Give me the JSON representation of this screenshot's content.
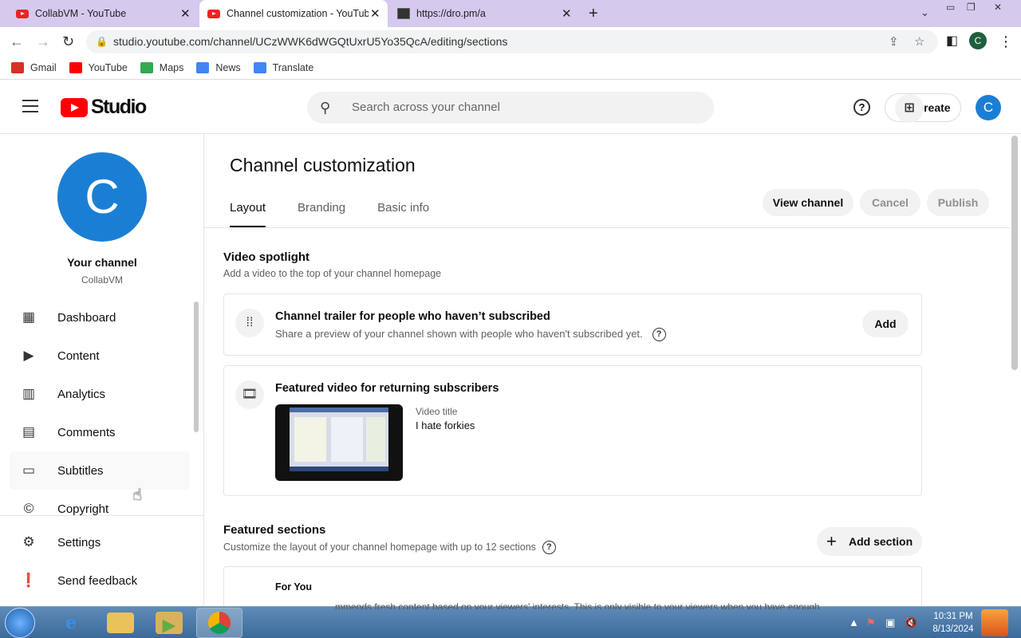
{
  "browser": {
    "tabs": [
      {
        "title": "CollabVM - YouTube",
        "icon": "youtube-favicon"
      },
      {
        "title": "Channel customization - YouTube Studio",
        "icon": "youtube-favicon"
      },
      {
        "title": "https://dro.pm/a",
        "icon": "dro-favicon"
      }
    ],
    "url": "studio.youtube.com/channel/UCzWWK6dWGQtUxrU5Yo35QcA/editing/sections",
    "profile_initial": "C",
    "bookmarks": [
      {
        "label": "Gmail",
        "color": "#d93025"
      },
      {
        "label": "YouTube",
        "color": "#ff0000"
      },
      {
        "label": "Maps",
        "color": "#34a853"
      },
      {
        "label": "News",
        "color": "#4285f4"
      },
      {
        "label": "Translate",
        "color": "#4285f4"
      }
    ]
  },
  "header": {
    "logo_text": "Studio",
    "search_placeholder": "Search across your channel",
    "create_label": "Create",
    "avatar_initial": "C"
  },
  "sidebar": {
    "avatar_initial": "C",
    "your_channel": "Your channel",
    "channel_name": "CollabVM",
    "items": [
      {
        "label": "Dashboard",
        "icon": "dashboard-icon"
      },
      {
        "label": "Content",
        "icon": "content-icon"
      },
      {
        "label": "Analytics",
        "icon": "analytics-icon"
      },
      {
        "label": "Comments",
        "icon": "comments-icon"
      },
      {
        "label": "Subtitles",
        "icon": "subtitles-icon"
      },
      {
        "label": "Copyright",
        "icon": "copyright-icon"
      }
    ],
    "bottom": [
      {
        "label": "Settings",
        "icon": "gear-icon"
      },
      {
        "label": "Send feedback",
        "icon": "feedback-icon"
      }
    ]
  },
  "main": {
    "title": "Channel customization",
    "tabs": [
      "Layout",
      "Branding",
      "Basic info"
    ],
    "view_channel": "View channel",
    "cancel": "Cancel",
    "publish": "Publish",
    "spotlight": {
      "title": "Video spotlight",
      "subtitle": "Add a video to the top of your channel homepage",
      "trailer_title": "Channel trailer for people who haven’t subscribed",
      "trailer_sub": "Share a preview of your channel shown with people who haven't subscribed yet.",
      "add": "Add",
      "featured_title": "Featured video for returning subscribers",
      "video_label": "Video title",
      "video_value": "I hate forkies"
    },
    "featured_sections": {
      "title": "Featured sections",
      "subtitle": "Customize the layout of your channel homepage with up to 12 sections",
      "add_section": "Add section",
      "for_you": "For You",
      "for_you_desc": "mmends fresh content based on your viewers' interests. This is only visible to your viewers when you have enough"
    }
  },
  "taskbar": {
    "time": "10:31 PM",
    "date": "8/13/2024"
  }
}
